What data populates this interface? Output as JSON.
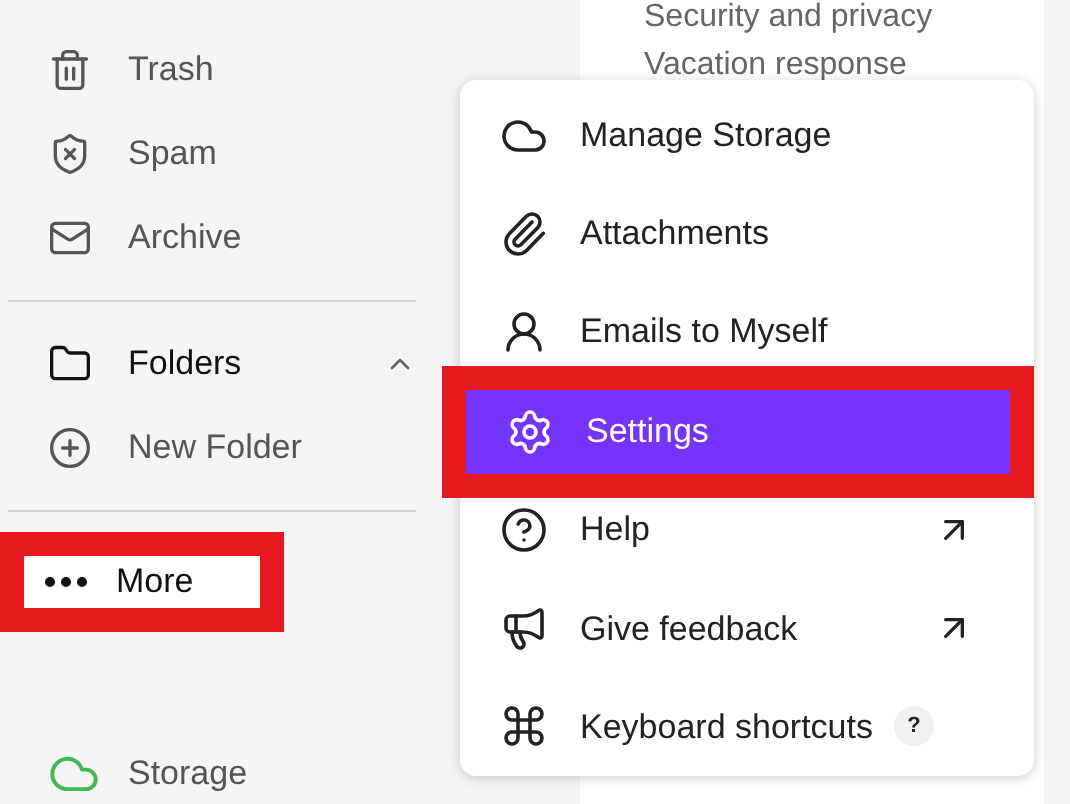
{
  "sidebar": {
    "items": [
      {
        "kind": "trash",
        "label": "Trash"
      },
      {
        "kind": "spam",
        "label": "Spam"
      },
      {
        "kind": "archive",
        "label": "Archive"
      },
      {
        "kind": "divider"
      },
      {
        "kind": "folders",
        "label": "Folders",
        "expanded": true
      },
      {
        "kind": "new-folder",
        "label": "New Folder"
      },
      {
        "kind": "divider"
      },
      {
        "kind": "more",
        "label": "More",
        "highlighted": true
      }
    ],
    "storage": {
      "label": "Storage"
    }
  },
  "settings_panel": {
    "items": [
      "Security and privacy",
      "Vacation response"
    ]
  },
  "menu": {
    "items": [
      {
        "kind": "cloud",
        "label": "Manage Storage",
        "selected": false
      },
      {
        "kind": "clip",
        "label": "Attachments",
        "selected": false
      },
      {
        "kind": "person",
        "label": "Emails to Myself",
        "selected": false
      },
      {
        "kind": "gear",
        "label": "Settings",
        "selected": true,
        "highlighted": true
      },
      {
        "kind": "help",
        "label": "Help",
        "selected": false,
        "external": true
      },
      {
        "kind": "megaphone",
        "label": "Give feedback",
        "selected": false,
        "external": true
      },
      {
        "kind": "command",
        "label": "Keyboard shortcuts",
        "selected": false,
        "shortcut": "?"
      }
    ]
  }
}
